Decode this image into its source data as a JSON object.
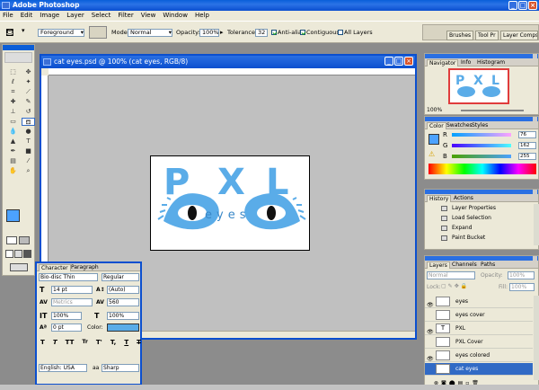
{
  "app": {
    "title": "Adobe Photoshop"
  },
  "menu": [
    "File",
    "Edit",
    "Image",
    "Layer",
    "Select",
    "Filter",
    "View",
    "Window",
    "Help"
  ],
  "options": {
    "sample_select": "Foreground",
    "mode_label": "Mode:",
    "mode_value": "Normal",
    "opacity_label": "Opacity:",
    "opacity_value": "100%",
    "tolerance_label": "Tolerance:",
    "tolerance_value": "32",
    "antialias_label": "Anti-alias",
    "contiguous_label": "Contiguous",
    "alllayers_label": "All Layers"
  },
  "palette_well": [
    "Brushes",
    "Tool Pr",
    "Layer Comps"
  ],
  "document": {
    "title": "cat eyes.psd @ 100% (cat eyes, RGB/8)",
    "artwork": {
      "letters": [
        "P",
        "X",
        "L"
      ],
      "sublabel": "eyes",
      "letter_color": "#5aace8"
    }
  },
  "navigator": {
    "tabs": [
      "Navigator",
      "Info",
      "Histogram"
    ],
    "zoom": "100%"
  },
  "color": {
    "tabs": [
      "Color",
      "Swatches",
      "Styles"
    ],
    "channels": [
      {
        "label": "R",
        "value": "76"
      },
      {
        "label": "G",
        "value": "162"
      },
      {
        "label": "B",
        "value": "255"
      }
    ],
    "swatch": "#4ca2ff"
  },
  "history": {
    "tabs": [
      "History",
      "Actions"
    ],
    "items": [
      "Layer Properties",
      "Load Selection",
      "Expand",
      "Paint Bucket"
    ]
  },
  "layers": {
    "tabs": [
      "Layers",
      "Channels",
      "Paths"
    ],
    "blend": "Normal",
    "opacity_label": "Opacity:",
    "opacity": "100%",
    "lock_label": "Lock:",
    "fill_label": "Fill:",
    "fill": "100%",
    "items": [
      {
        "name": "eyes",
        "type": "thumb",
        "visible": true,
        "selected": false
      },
      {
        "name": "eyes cover",
        "type": "thumb",
        "visible": false,
        "selected": false
      },
      {
        "name": "PXL",
        "type": "text",
        "visible": true,
        "selected": false
      },
      {
        "name": "PXL Cover",
        "type": "thumb",
        "visible": false,
        "selected": false
      },
      {
        "name": "eyes colored",
        "type": "thumb",
        "visible": true,
        "selected": false
      },
      {
        "name": "cat eyes",
        "type": "thumb",
        "visible": false,
        "selected": true
      }
    ]
  },
  "character": {
    "tabs": [
      "Character",
      "Paragraph"
    ],
    "font": "Bio-disc Thin",
    "style": "Regular",
    "size": "14 pt",
    "leading": "(Auto)",
    "kerning": "Metrics",
    "tracking": "560",
    "vscale": "100%",
    "hscale": "100%",
    "baseline": "0 pt",
    "color_label": "Color:",
    "color": "#5aace8",
    "styles": [
      "T",
      "T",
      "TT",
      "Tr",
      "T'",
      "T,",
      "T",
      "T"
    ],
    "language": "English: USA",
    "antialias_label": "aa",
    "antialias": "Sharp"
  },
  "colors": {
    "accent": "#0b4fcf",
    "art": "#5aace8",
    "selected": "#316ac5"
  }
}
